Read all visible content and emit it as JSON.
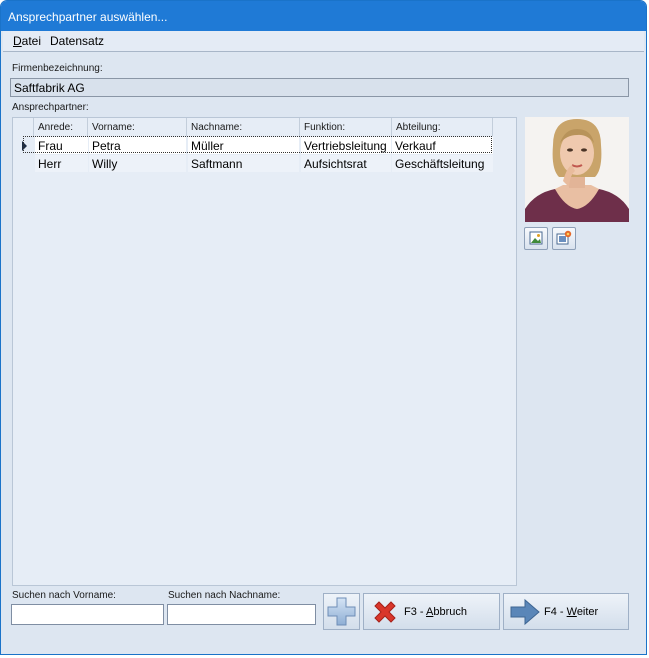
{
  "window": {
    "title": "Ansprechpartner auswählen..."
  },
  "menu": {
    "datei_u": "D",
    "datei_rest": "atei",
    "datensatz": "Datensatz"
  },
  "company": {
    "label": "Firmenbezeichnung:",
    "value": "Saftfabrik AG"
  },
  "contacts": {
    "label": "Ansprechpartner:",
    "columns": [
      "Anrede:",
      "Vorname:",
      "Nachname:",
      "Funktion:",
      "Abteilung:"
    ],
    "rows": [
      [
        "Frau",
        "Petra",
        "Müller",
        "Vertriebsleitung",
        "Verkauf"
      ],
      [
        "Herr",
        "Willy",
        "Saftmann",
        "Aufsichtsrat",
        "Geschäftsleitung"
      ]
    ],
    "selected_row": 0
  },
  "photo": {
    "icons": [
      "image-load-icon",
      "image-edit-icon"
    ]
  },
  "search": {
    "firstname_label": "Suchen nach Vorname:",
    "firstname_value": "",
    "lastname_label": "Suchen nach Nachname:",
    "lastname_value": ""
  },
  "buttons": {
    "add_icon": "plus-icon",
    "cancel_pre": "F3 - ",
    "cancel_u": "A",
    "cancel_rest": "bbruch",
    "next_pre": "F4 - ",
    "next_u": "W",
    "next_rest": "eiter"
  },
  "colors": {
    "titlebar": "#1f7ad6",
    "background": "#dde6f1",
    "cancel_x": "#d9362b",
    "arrow": "#5a86b8"
  }
}
